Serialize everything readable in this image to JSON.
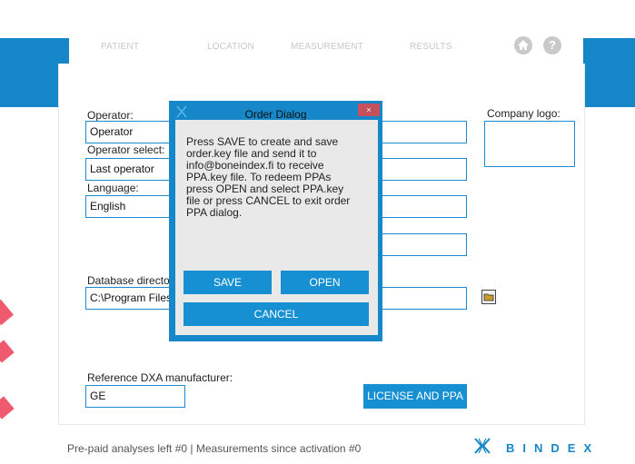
{
  "tabs": [
    "PATIENT",
    "LOCATION",
    "MEASUREMENT",
    "RESULTS"
  ],
  "header": {
    "home_icon": "home-icon",
    "help_icon": "question-icon",
    "help_glyph": "?"
  },
  "form": {
    "operator_label": "Operator:",
    "operator_value": "Operator",
    "operator_select_label": "Operator select:",
    "operator_select_value": "Last operator",
    "language_label": "Language:",
    "language_value": "English",
    "company_logo_label": "Company logo:",
    "database_label": "Database directo",
    "database_value": "C:\\Program Files",
    "dxa_label": "Reference DXA manufacturer:",
    "dxa_value": "GE",
    "license_button": "LICENSE AND PPA"
  },
  "footer": {
    "status": "Pre-paid analyses left #0 | Measurements since activation #0",
    "brand": "BINDEX"
  },
  "dialog": {
    "title": "Order Dialog",
    "close_glyph": "×",
    "message": "Press SAVE to create and save order.key file and send it to info@boneindex.fi to receive PPA.key file. To redeem PPAs press OPEN and select PPA.key file or press CANCEL to exit order PPA dialog.",
    "save_label": "SAVE",
    "open_label": "OPEN",
    "cancel_label": "CANCEL"
  },
  "colors": {
    "accent": "#1587c8",
    "button": "#1690d3",
    "close": "#c7505d",
    "decoration": "#f05a6e"
  }
}
